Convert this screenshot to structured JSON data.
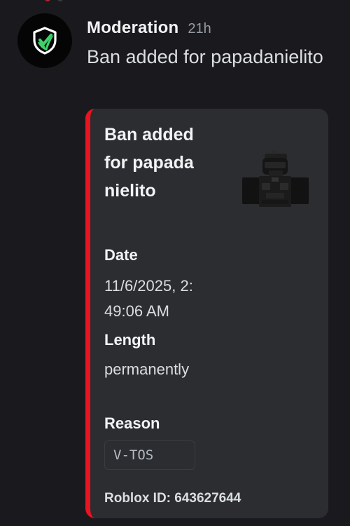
{
  "message": {
    "author": "Moderation",
    "timestamp": "21h",
    "content": "Ban added for papadanielito",
    "avatar_icon": "shield-check-icon"
  },
  "embed": {
    "accent_color": "#e8141f",
    "title": "Ban added for papadanielito",
    "thumbnail_icon": "roblox-avatar-thumbnail",
    "fields": [
      {
        "name": "Date",
        "value": "11/6/2025, 2:49:06 AM"
      },
      {
        "name": "Length",
        "value": "permanently"
      },
      {
        "name": "Reason",
        "value": "V-TOS"
      }
    ],
    "footer": "Roblox ID: 643627644"
  }
}
